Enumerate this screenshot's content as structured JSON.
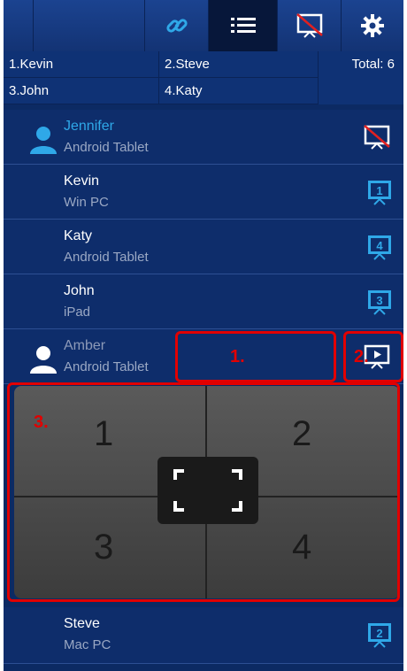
{
  "toolbar": {
    "icons": [
      "link-icon",
      "list-icon",
      "screen-off-icon",
      "gear-icon"
    ],
    "active": "list-icon"
  },
  "presenters": {
    "cells": [
      "1.Kevin",
      "2.Steve",
      "3.John",
      "4.Katy"
    ],
    "total_label": "Total: 6"
  },
  "devices": [
    {
      "name": "Jennifer",
      "type": "Android Tablet",
      "state": "self",
      "icon": "screen-off-icon"
    },
    {
      "name": "Kevin",
      "type": "Win PC",
      "slot": "1"
    },
    {
      "name": "Katy",
      "type": "Android Tablet",
      "slot": "4"
    },
    {
      "name": "John",
      "type": "iPad",
      "slot": "3"
    },
    {
      "name": "Amber",
      "type": "Android Tablet",
      "state": "idle",
      "icon": "play-screen-icon"
    },
    {
      "name": "Steve",
      "type": "Mac PC",
      "slot": "2"
    }
  ],
  "quadrants": [
    "1",
    "2",
    "3",
    "4"
  ],
  "callouts": [
    "1.",
    "2.",
    "3."
  ],
  "colors": {
    "highlight_name": "#2fa8e8",
    "callout_red": "#e10000",
    "background": "#0c2a63"
  }
}
